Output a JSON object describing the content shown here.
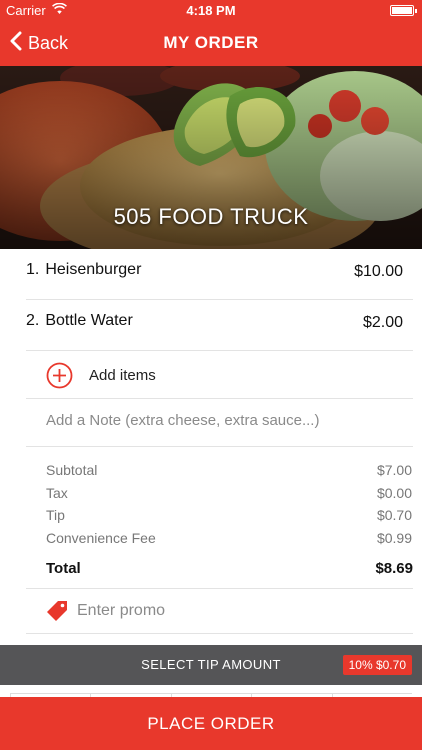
{
  "status_bar": {
    "carrier": "Carrier",
    "time": "4:18 PM"
  },
  "nav": {
    "back_label": "Back",
    "title": "MY ORDER"
  },
  "hero": {
    "title": "505 FOOD TRUCK"
  },
  "order_items": [
    {
      "number": "1.",
      "name": "Heisenburger",
      "price": "$10.00"
    },
    {
      "number": "2.",
      "name": "Bottle Water",
      "price": "$2.00"
    }
  ],
  "add_items_label": "Add items",
  "note": {
    "placeholder": "Add a Note (extra cheese, extra sauce...)"
  },
  "summary": {
    "rows": [
      {
        "label": "Subtotal",
        "value": "$7.00"
      },
      {
        "label": "Tax",
        "value": "$0.00"
      },
      {
        "label": "Tip",
        "value": "$0.70"
      },
      {
        "label": "Convenience Fee",
        "value": "$0.99"
      }
    ],
    "total_label": "Total",
    "total_value": "$8.69"
  },
  "promo": {
    "placeholder": "Enter promo"
  },
  "tip": {
    "label": "SELECT TIP AMOUNT",
    "badge": "10% $0.70"
  },
  "place_order_label": "PLACE ORDER",
  "colors": {
    "accent": "#e8382c",
    "tip_bar": "#555557"
  },
  "icons": [
    "wifi-icon",
    "battery-icon",
    "chevron-left-icon",
    "plus-circle-icon",
    "tag-icon"
  ]
}
